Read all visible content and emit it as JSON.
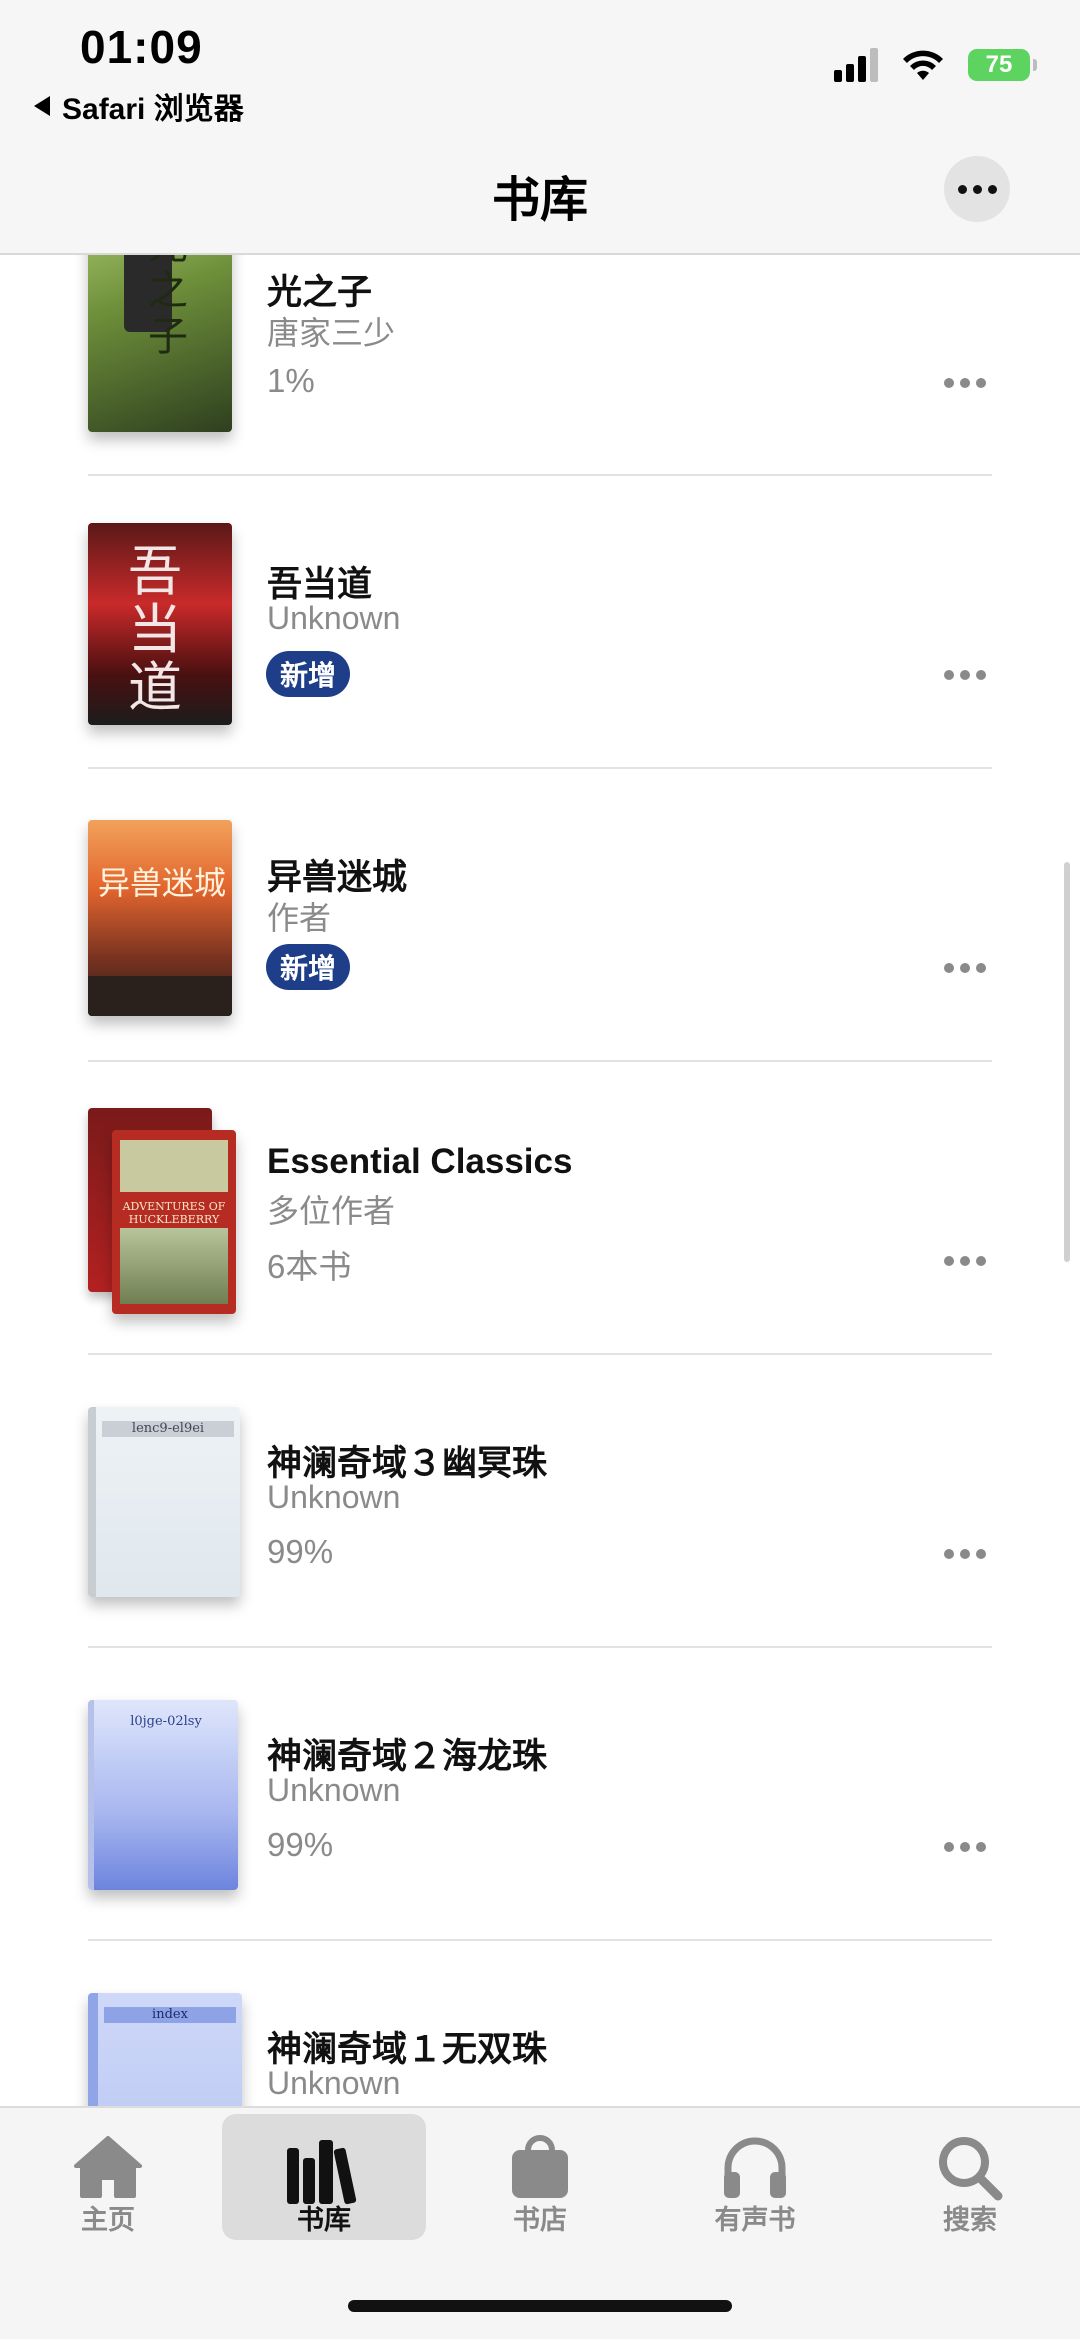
{
  "status_bar": {
    "time": "01:09",
    "back_label": "Safari 浏览器",
    "battery": "75"
  },
  "nav": {
    "title": "书库"
  },
  "books": [
    {
      "title": "光之子",
      "author": "唐家三少",
      "meta": "1%",
      "badge": null,
      "cover_text": "光之子"
    },
    {
      "title": "吾当道",
      "author": "Unknown",
      "meta": null,
      "badge": "新增",
      "cover_text": "吾当道"
    },
    {
      "title": "异兽迷城",
      "author": "作者",
      "meta": null,
      "badge": "新增",
      "cover_text": "异兽迷城"
    },
    {
      "title": "Essential Classics",
      "author": "多位作者",
      "meta": "6本书",
      "badge": null,
      "cover_text": "ADVENTURES OF HUCKLEBERRY FINN MARK TWAIN"
    },
    {
      "title": "神澜奇域３幽冥珠",
      "author": "Unknown",
      "meta": "99%",
      "badge": null,
      "cover_text": "lenc9-el9ei"
    },
    {
      "title": "神澜奇域２海龙珠",
      "author": "Unknown",
      "meta": "99%",
      "badge": null,
      "cover_text": "l0jge-02lsy"
    },
    {
      "title": "神澜奇域１无双珠",
      "author": "Unknown",
      "meta": null,
      "badge": null,
      "cover_text": "index"
    }
  ],
  "tabs": [
    {
      "label": "主页",
      "icon": "home-icon"
    },
    {
      "label": "书库",
      "icon": "library-icon",
      "active": true
    },
    {
      "label": "书店",
      "icon": "bag-icon"
    },
    {
      "label": "有声书",
      "icon": "headphones-icon"
    },
    {
      "label": "搜索",
      "icon": "search-icon"
    }
  ]
}
